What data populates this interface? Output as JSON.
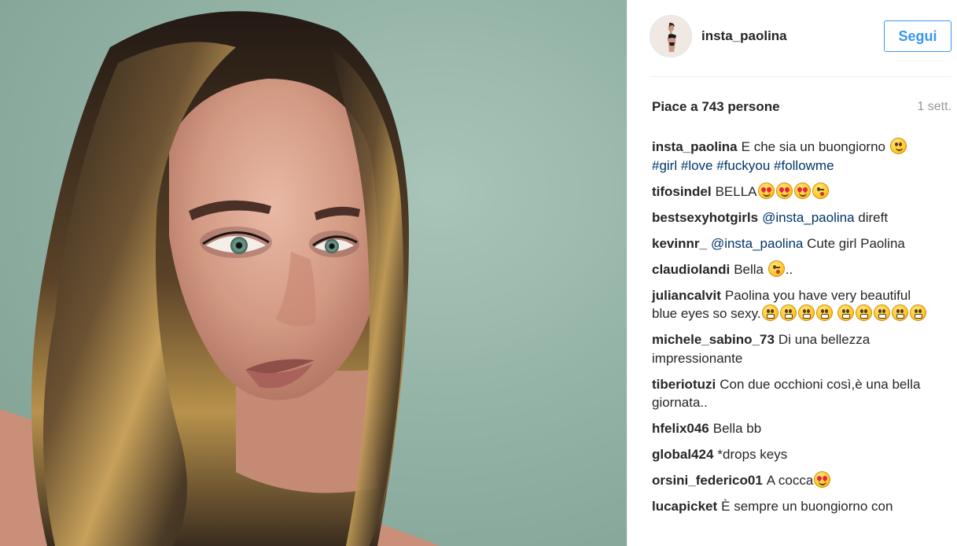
{
  "post": {
    "author": "insta_paolina",
    "follow_label": "Segui",
    "likes_text": "Piace a 743 persone",
    "time_text": "1 sett."
  },
  "icons": {
    "avatar": "profile-avatar",
    "emoji_smile": "smiling-face-emoji",
    "emoji_heart_eyes": "heart-eyes-emoji",
    "emoji_kiss": "face-blowing-kiss-emoji",
    "emoji_grin": "grinning-face-emoji"
  },
  "colors": {
    "accent": "#3897f0",
    "hashtag": "#003569",
    "muted": "#999999",
    "text": "#262626"
  },
  "comments": [
    {
      "user": "insta_paolina",
      "parts": [
        {
          "t": "text",
          "v": "E che sia un buongiorno "
        },
        {
          "t": "emoji",
          "v": "smile"
        },
        {
          "t": "text",
          "v": " "
        },
        {
          "t": "link",
          "v": "#girl"
        },
        {
          "t": "text",
          "v": " "
        },
        {
          "t": "link",
          "v": "#love"
        },
        {
          "t": "text",
          "v": " "
        },
        {
          "t": "link",
          "v": "#fuckyou"
        },
        {
          "t": "text",
          "v": " "
        },
        {
          "t": "link",
          "v": "#followme"
        }
      ]
    },
    {
      "user": "tifosindel",
      "parts": [
        {
          "t": "text",
          "v": "BELLA"
        },
        {
          "t": "emoji",
          "v": "heart"
        },
        {
          "t": "emoji",
          "v": "heart"
        },
        {
          "t": "emoji",
          "v": "heart"
        },
        {
          "t": "emoji",
          "v": "kiss"
        }
      ]
    },
    {
      "user": "bestsexyhotgirls",
      "parts": [
        {
          "t": "link",
          "v": "@insta_paolina"
        },
        {
          "t": "text",
          "v": " direft"
        }
      ]
    },
    {
      "user": "kevinnr_",
      "parts": [
        {
          "t": "link",
          "v": "@insta_paolina"
        },
        {
          "t": "text",
          "v": " Cute girl Paolina"
        }
      ]
    },
    {
      "user": "claudiolandi",
      "parts": [
        {
          "t": "text",
          "v": "Bella "
        },
        {
          "t": "emoji",
          "v": "kiss"
        },
        {
          "t": "text",
          "v": ".."
        }
      ]
    },
    {
      "user": "juliancalvit",
      "parts": [
        {
          "t": "text",
          "v": "Paolina you have very beautiful blue eyes so sexy."
        },
        {
          "t": "emoji",
          "v": "grin"
        },
        {
          "t": "emoji",
          "v": "grin"
        },
        {
          "t": "emoji",
          "v": "grin"
        },
        {
          "t": "emoji",
          "v": "grin"
        },
        {
          "t": "text",
          "v": " "
        },
        {
          "t": "emoji",
          "v": "grin"
        },
        {
          "t": "emoji",
          "v": "grin"
        },
        {
          "t": "emoji",
          "v": "grin"
        },
        {
          "t": "emoji",
          "v": "grin"
        },
        {
          "t": "emoji",
          "v": "grin"
        }
      ]
    },
    {
      "user": "michele_sabino_73",
      "parts": [
        {
          "t": "text",
          "v": "Di una bellezza impressionante"
        }
      ]
    },
    {
      "user": "tiberiotuzi",
      "parts": [
        {
          "t": "text",
          "v": "Con due occhioni così,è una bella giornata.."
        }
      ]
    },
    {
      "user": "hfelix046",
      "parts": [
        {
          "t": "text",
          "v": "Bella bb"
        }
      ]
    },
    {
      "user": "global424",
      "parts": [
        {
          "t": "text",
          "v": "*drops keys"
        }
      ]
    },
    {
      "user": "orsini_federico01",
      "parts": [
        {
          "t": "text",
          "v": "A cocca"
        },
        {
          "t": "emoji",
          "v": "heart"
        }
      ]
    },
    {
      "user": "lucapicket",
      "parts": [
        {
          "t": "text",
          "v": "È sempre un buongiorno con"
        }
      ]
    }
  ]
}
